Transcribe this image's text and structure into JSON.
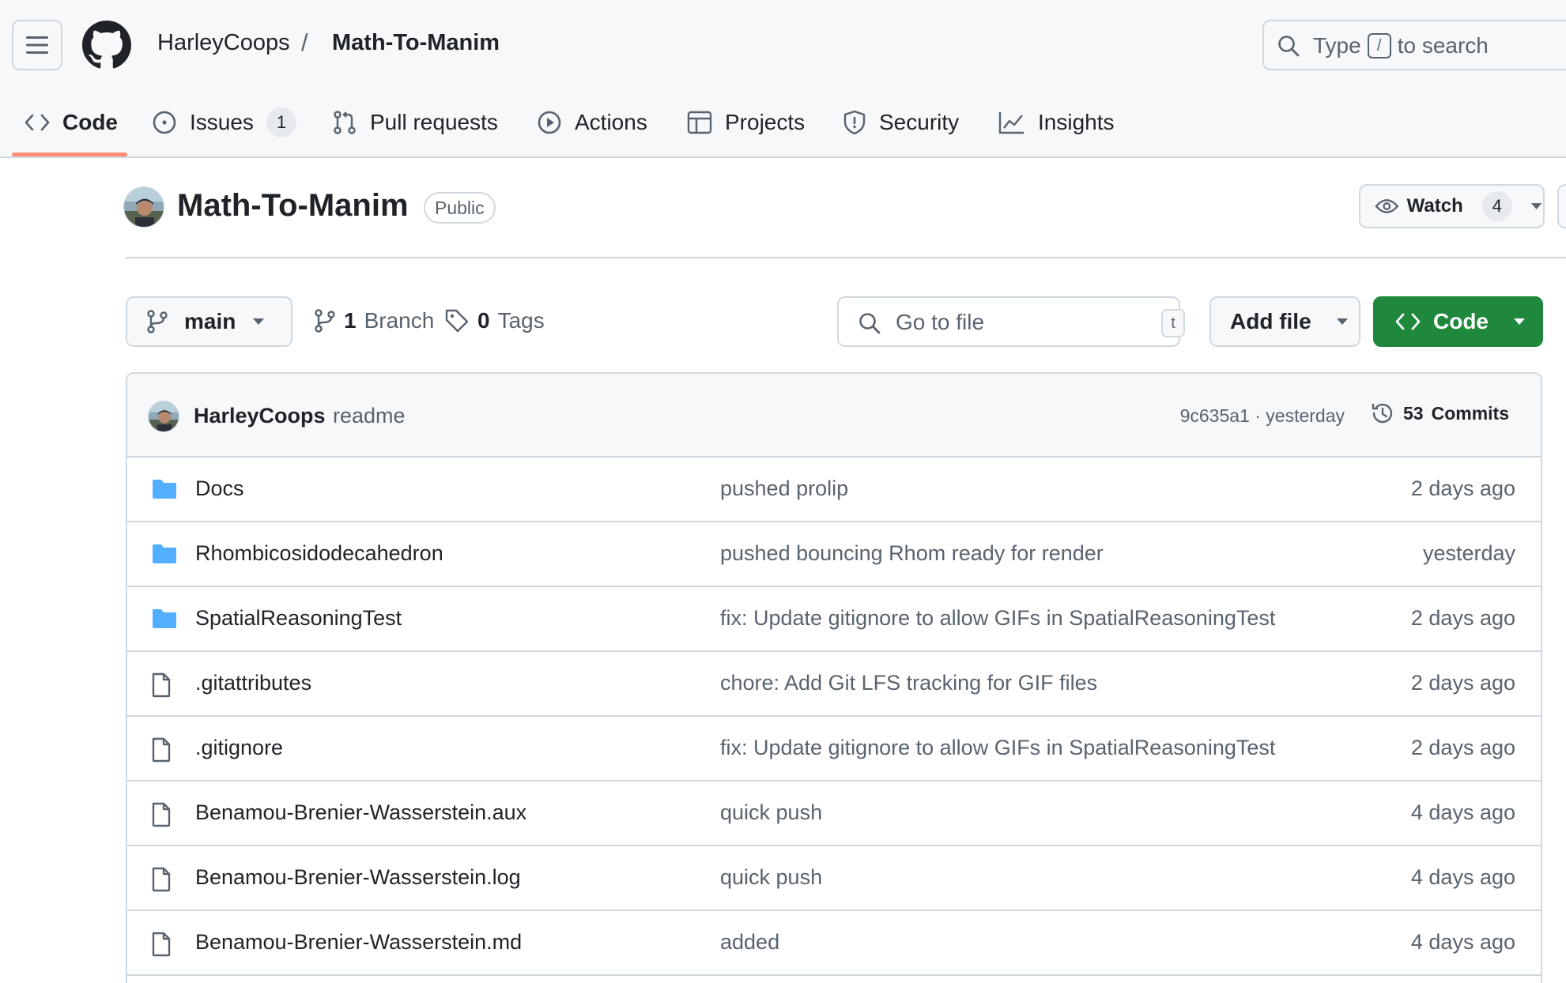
{
  "header": {
    "owner": "HarleyCoops",
    "separator": "/",
    "repo": "Math-To-Manim",
    "search_prefix": "Type",
    "search_key": "/",
    "search_suffix": "to search"
  },
  "tabs": [
    {
      "label": "Code",
      "icon": "code-icon"
    },
    {
      "label": "Issues",
      "icon": "issue-opened-icon",
      "count": "1"
    },
    {
      "label": "Pull requests",
      "icon": "git-pull-request-icon"
    },
    {
      "label": "Actions",
      "icon": "play-icon"
    },
    {
      "label": "Projects",
      "icon": "table-icon"
    },
    {
      "label": "Security",
      "icon": "shield-icon"
    },
    {
      "label": "Insights",
      "icon": "graph-icon"
    }
  ],
  "repo": {
    "title": "Math-To-Manim",
    "visibility": "Public",
    "watch_label": "Watch",
    "watch_count": "4"
  },
  "controls": {
    "branch": "main",
    "branch_count": "1",
    "branch_label": "Branch",
    "tags_count": "0",
    "tags_label": "Tags",
    "goto_placeholder": "Go to file",
    "goto_key": "t",
    "add_file": "Add file",
    "code_button": "Code"
  },
  "latest_commit": {
    "author": "HarleyCoops",
    "message": "readme",
    "sha": "9c635a1",
    "dot": "·",
    "time": "yesterday",
    "commits_count": "53",
    "commits_label": "Commits"
  },
  "files": [
    {
      "type": "folder",
      "name": "Docs",
      "message": "pushed prolip",
      "time": "2 days ago"
    },
    {
      "type": "folder",
      "name": "Rhombicosidodecahedron",
      "message": "pushed bouncing Rhom ready for render",
      "time": "yesterday"
    },
    {
      "type": "folder",
      "name": "SpatialReasoningTest",
      "message": "fix: Update gitignore to allow GIFs in SpatialReasoningTest",
      "time": "2 days ago"
    },
    {
      "type": "file",
      "name": ".gitattributes",
      "message": "chore: Add Git LFS tracking for GIF files",
      "time": "2 days ago"
    },
    {
      "type": "file",
      "name": ".gitignore",
      "message": "fix: Update gitignore to allow GIFs in SpatialReasoningTest",
      "time": "2 days ago"
    },
    {
      "type": "file",
      "name": "Benamou-Brenier-Wasserstein.aux",
      "message": "quick push",
      "time": "4 days ago"
    },
    {
      "type": "file",
      "name": "Benamou-Brenier-Wasserstein.log",
      "message": "quick push",
      "time": "4 days ago"
    },
    {
      "type": "file",
      "name": "Benamou-Brenier-Wasserstein.md",
      "message": "added",
      "time": "4 days ago"
    }
  ],
  "colors": {
    "accent_underline": "#fd8c73",
    "primary_button": "#1f883d",
    "folder": "#54aeff",
    "border": "#d1d9e0"
  }
}
